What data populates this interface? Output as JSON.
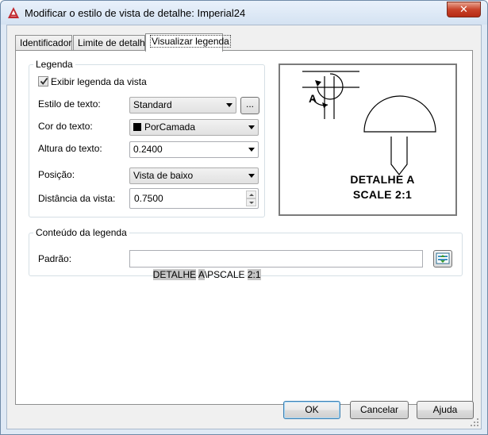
{
  "window": {
    "title": "Modificar o estilo de vista de detalhe: Imperial24",
    "close_label": "✕"
  },
  "tabs": [
    {
      "label": "Identificador"
    },
    {
      "label": "Limite de detalhe"
    },
    {
      "label": "Visualizar legenda"
    }
  ],
  "legend_group": {
    "title": "Legenda",
    "show_label_checkbox": {
      "label": "Exibir legenda da vista",
      "checked": true
    },
    "text_style": {
      "label": "Estilo de texto:",
      "value": "Standard",
      "browse_label": "..."
    },
    "text_color": {
      "label": "Cor do texto:",
      "value": "PorCamada",
      "swatch_color": "#000000"
    },
    "text_height": {
      "label": "Altura do texto:",
      "value": "0.2400"
    },
    "position": {
      "label": "Posição:",
      "value": "Vista de baixo"
    },
    "distance": {
      "label": "Distância da vista:",
      "value": "0.7500"
    }
  },
  "preview": {
    "marker_letter": "A",
    "line1": "DETALHE A",
    "line2": "SCALE 2:1"
  },
  "content_group": {
    "title": "Conteúdo da legenda",
    "pattern_label": "Padrão:",
    "pattern_tokens": [
      {
        "text": "DETALHE",
        "field": true
      },
      {
        "text": " ",
        "field": false
      },
      {
        "text": "A",
        "field": true
      },
      {
        "text": "\\PSCALE ",
        "field": false
      },
      {
        "text": "2:1",
        "field": true
      }
    ]
  },
  "footer": {
    "ok": "OK",
    "cancel": "Cancelar",
    "help": "Ajuda"
  },
  "colors": {
    "title_bar": "#dfe9f5",
    "close_button": "#c8432a",
    "default_button_border": "#3c7fb1",
    "field_highlight": "#c6c6c6"
  }
}
